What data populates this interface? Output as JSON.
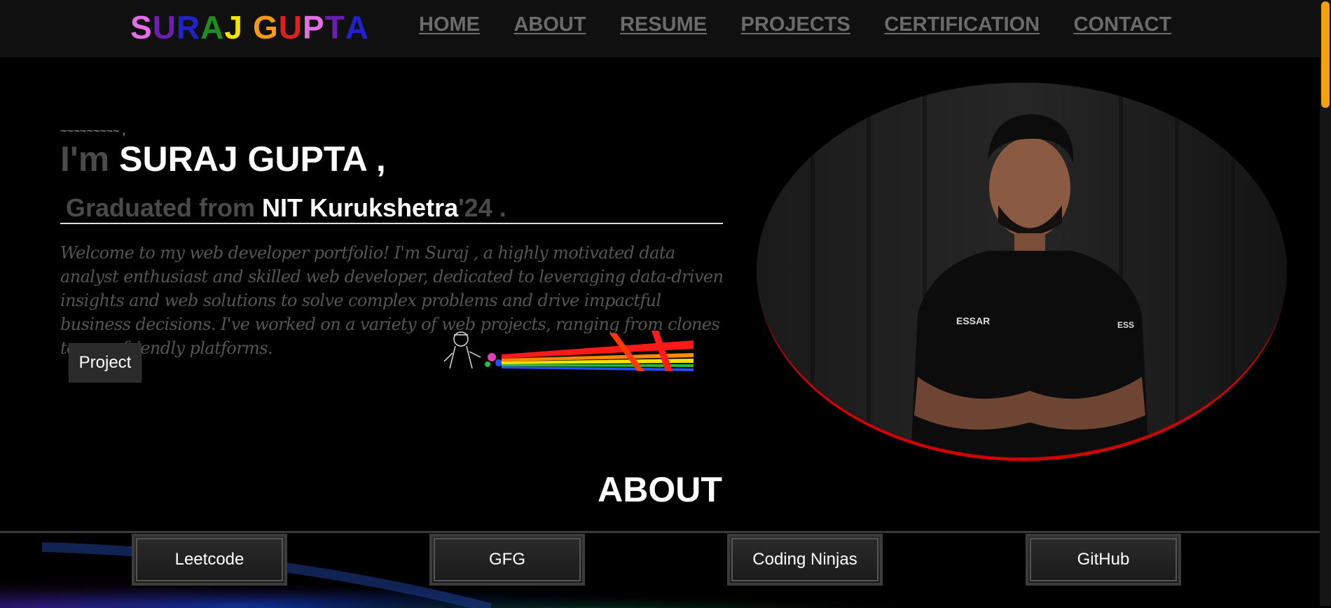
{
  "header": {
    "logo_letters": [
      {
        "ch": "S",
        "color": "#e26ee6"
      },
      {
        "ch": "U",
        "color": "#6a1fb0"
      },
      {
        "ch": "R",
        "color": "#2222cc"
      },
      {
        "ch": "A",
        "color": "#1f8f1f"
      },
      {
        "ch": "J",
        "color": "#f2e600"
      },
      {
        "ch": " ",
        "color": "#ffffff"
      },
      {
        "ch": "G",
        "color": "#f59a10"
      },
      {
        "ch": "U",
        "color": "#e0201e"
      },
      {
        "ch": "P",
        "color": "#e26ee6"
      },
      {
        "ch": "T",
        "color": "#6a1fb0"
      },
      {
        "ch": "A",
        "color": "#2222cc"
      }
    ],
    "nav": [
      "HOME",
      "ABOUT",
      "RESUME",
      "PROJECTS",
      "CERTIFICATION",
      "CONTACT"
    ]
  },
  "hero": {
    "intro_prefix": "I'm ",
    "intro_name": "SURAJ GUPTA ,",
    "grad_prefix": "Graduated from ",
    "grad_college": "NIT Kurukshetra",
    "grad_suffix": "'24 .",
    "paragraph": "Welcome to my web developer portfolio! I'm Suraj , a highly motivated data analyst enthusiast and skilled web developer, dedicated to leveraging data-driven insights and web solutions to solve complex problems and drive impactful business decisions. I've worked on a variety of web projects, ranging from clones to user friendly platforms.",
    "project_button": "Project"
  },
  "about": {
    "title": "ABOUT",
    "profiles": [
      "Leetcode",
      "GFG",
      "Coding Ninjas",
      "GitHub"
    ]
  },
  "colors": {
    "accent_red": "#d00000",
    "scrollbar": "#f5a10e",
    "nav_link": "#6b6b6b"
  }
}
